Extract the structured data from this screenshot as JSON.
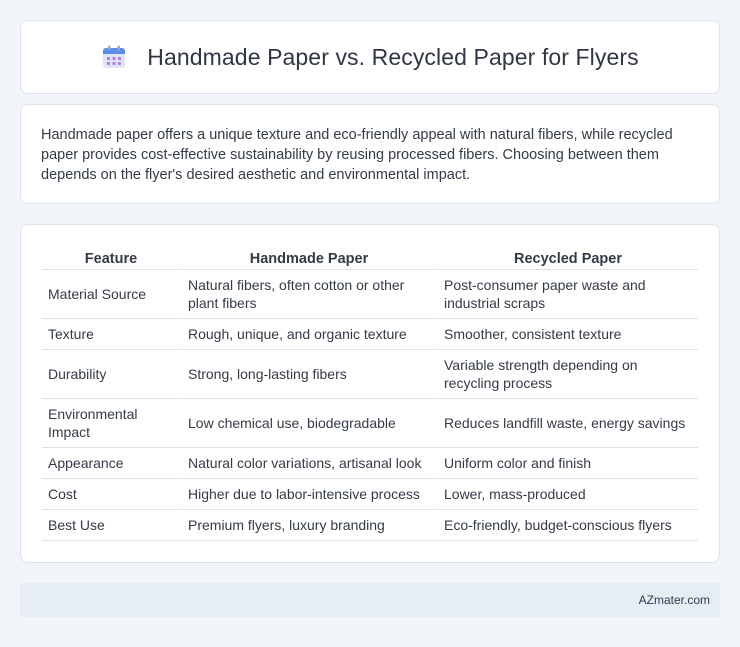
{
  "header": {
    "title": "Handmade Paper vs. Recycled Paper for Flyers",
    "icon": "calendar-icon"
  },
  "summary": {
    "text": "Handmade paper offers a unique texture and eco-friendly appeal with natural fibers, while recycled paper provides cost-effective sustainability by reusing processed fibers. Choosing between them depends on the flyer's desired aesthetic and environmental impact."
  },
  "table": {
    "headers": [
      "Feature",
      "Handmade Paper",
      "Recycled Paper"
    ],
    "rows": [
      [
        "Material Source",
        "Natural fibers, often cotton or other plant fibers",
        "Post-consumer paper waste and industrial scraps"
      ],
      [
        "Texture",
        "Rough, unique, and organic texture",
        "Smoother, consistent texture"
      ],
      [
        "Durability",
        "Strong, long-lasting fibers",
        "Variable strength depending on recycling process"
      ],
      [
        "Environmental Impact",
        "Low chemical use, biodegradable",
        "Reduces landfill waste, energy savings"
      ],
      [
        "Appearance",
        "Natural color variations, artisanal look",
        "Uniform color and finish"
      ],
      [
        "Cost",
        "Higher due to labor-intensive process",
        "Lower, mass-produced"
      ],
      [
        "Best Use",
        "Premium flyers, luxury branding",
        "Eco-friendly, budget-conscious flyers"
      ]
    ]
  },
  "footer": {
    "text": "AZmater.com"
  }
}
